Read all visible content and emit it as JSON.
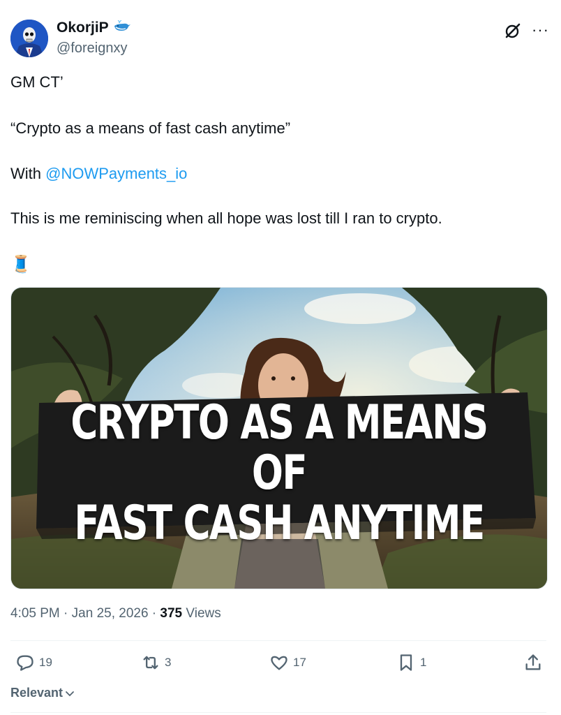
{
  "author": {
    "name": "OkorjiP",
    "name_badge_icon": "whale-emoji-icon",
    "handle": "@foreignxy",
    "avatar_icon": "skeleton-in-blue-suit-avatar"
  },
  "header_actions": {
    "grok_icon": "grok-icon",
    "more": "···"
  },
  "post": {
    "line1": "GM CT’",
    "line2": "“Crypto as a means of fast cash anytime”",
    "line3_prefix": "With ",
    "line3_mention": "@NOWPayments_io",
    "line4": "This is me reminiscing when all hope was lost till I ran to crypto.",
    "thread_emoji": "🧵"
  },
  "media": {
    "overlay_line1": "CRYPTO AS A MEANS OF",
    "overlay_line2": "FAST CASH ANYTIME"
  },
  "meta": {
    "time": "4:05 PM",
    "sep1": " · ",
    "date": "Jan 25, 2026",
    "sep2": " · ",
    "views_count": "375",
    "views_label": " Views"
  },
  "actions": {
    "replies": "19",
    "reposts": "3",
    "likes": "17",
    "bookmarks": "1"
  },
  "sort": {
    "label": "Relevant"
  },
  "colors": {
    "link": "#1d9bf0",
    "muted": "#536471",
    "text": "#0f1419"
  }
}
